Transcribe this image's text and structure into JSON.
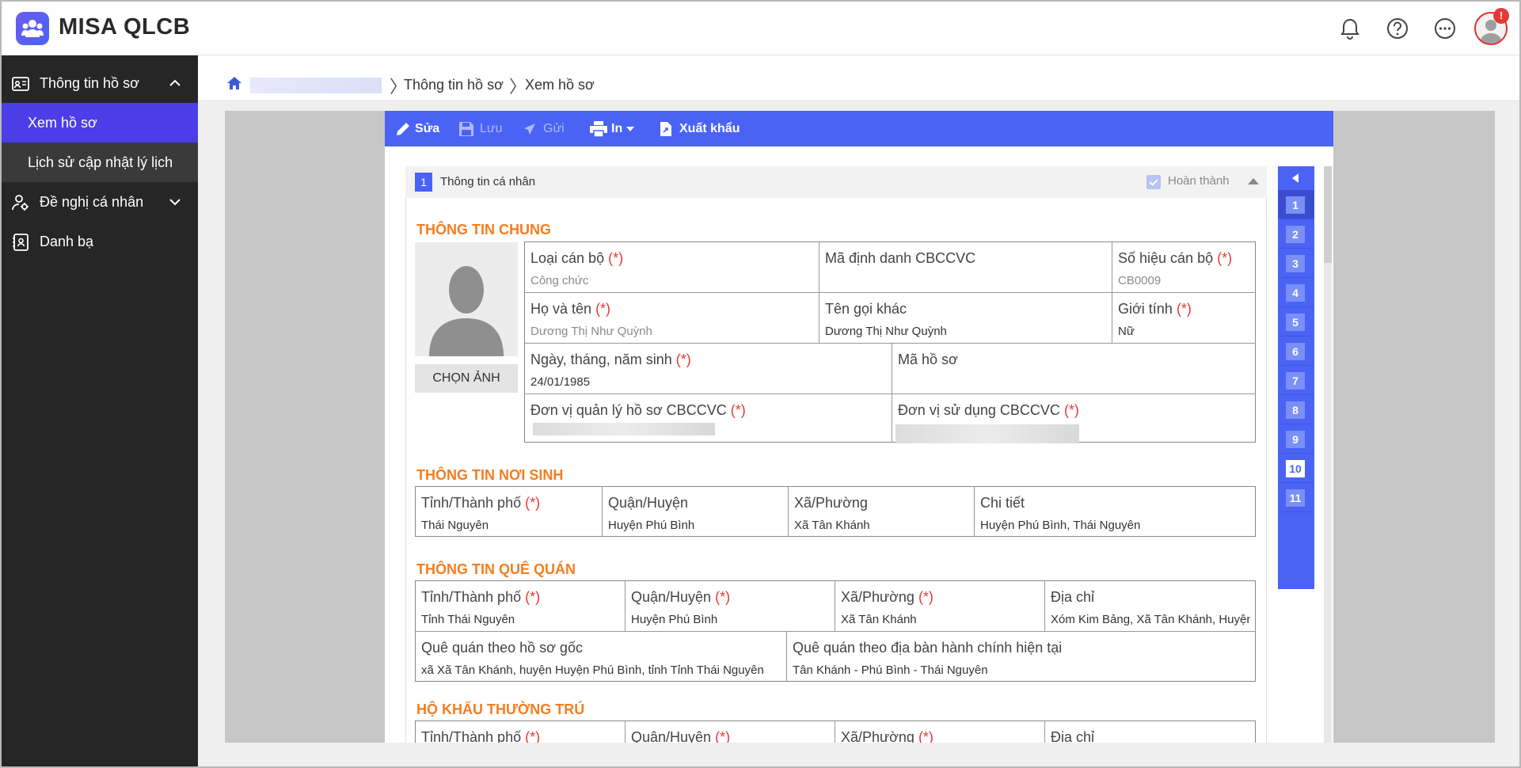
{
  "app": {
    "title": "MISA QLCB",
    "notification_badge": "!"
  },
  "sidebar": {
    "items": [
      {
        "label": "Thông tin hồ sơ",
        "icon": "id-card-icon",
        "expanded": true
      },
      {
        "label": "Xem hồ sơ",
        "active": true
      },
      {
        "label": "Lịch sử cập nhật lý lịch"
      },
      {
        "label": "Đề nghị cá nhân",
        "icon": "user-settings-icon",
        "expanded": false
      },
      {
        "label": "Danh bạ",
        "icon": "contacts-icon"
      }
    ]
  },
  "breadcrumb": {
    "items": [
      "Thông tin hồ sơ",
      "Xem hồ sơ"
    ]
  },
  "toolbar": {
    "edit": "Sửa",
    "save": "Lưu",
    "send": "Gửi",
    "print": "In",
    "export": "Xuất khẩu"
  },
  "panel": {
    "number": "1",
    "title": "Thông tin cá nhân",
    "status": "Hoàn thành"
  },
  "choose_photo": "CHỌN ẢNH",
  "required_mark": "(*)",
  "general": {
    "title": "THÔNG TIN CHUNG",
    "loai_can_bo": {
      "label": "Loại cán bộ",
      "value": "Công chức"
    },
    "ma_dinh_danh": {
      "label": "Mã định danh CBCCVC",
      "value": ""
    },
    "so_hieu": {
      "label": "Số hiệu cán bộ",
      "value": "CB0009"
    },
    "ho_ten": {
      "label": "Họ và tên",
      "value": "Dương Thị Như Quỳnh"
    },
    "ten_goi_khac": {
      "label": "Tên gọi khác",
      "value": "Dương Thị Như Quỳnh"
    },
    "gioi_tinh": {
      "label": "Giới tính",
      "value": "Nữ"
    },
    "ngay_sinh": {
      "label": "Ngày, tháng, năm sinh",
      "value": "24/01/1985"
    },
    "ma_ho_so": {
      "label": "Mã hồ sơ",
      "value": ""
    },
    "don_vi_quan_ly": {
      "label": "Đơn vị quản lý hồ sơ CBCCVC"
    },
    "don_vi_su_dung": {
      "label": "Đơn vị sử dụng CBCCVC"
    }
  },
  "birthplace": {
    "title": "THÔNG TIN NƠI SINH",
    "cells": [
      {
        "label": "Tỉnh/Thành phố",
        "required": true,
        "value": "Thái Nguyên"
      },
      {
        "label": "Quận/Huyện",
        "required": false,
        "value": "Huyện Phú Bình"
      },
      {
        "label": "Xã/Phường",
        "required": false,
        "value": "Xã Tân Khánh"
      },
      {
        "label": "Chi tiết",
        "required": false,
        "value": "Huyện Phú Bình, Thái Nguyên"
      }
    ]
  },
  "hometown": {
    "title": "THÔNG TIN QUÊ QUÁN",
    "cells": [
      {
        "label": "Tỉnh/Thành phố",
        "required": true,
        "value": "Tỉnh Thái Nguyên"
      },
      {
        "label": "Quận/Huyện",
        "required": true,
        "value": "Huyện Phú Bình"
      },
      {
        "label": "Xã/Phường",
        "required": true,
        "value": "Xã Tân Khánh"
      },
      {
        "label": "Địa chỉ",
        "required": false,
        "value": "Xóm Kim Bảng, Xã Tân Khánh, Huyện Phú Bình"
      }
    ],
    "original": {
      "label": "Quê quán theo hồ sơ gốc",
      "value": "xã Xã Tân Khánh, huyện Huyện Phú Bình, tỉnh Tỉnh Thái Nguyên"
    },
    "current": {
      "label": "Quê quán theo địa bàn hành chính hiện tại",
      "value": "Tân Khánh - Phú Bình - Thái Nguyên"
    }
  },
  "residence": {
    "title": "HỘ KHẨU THƯỜNG TRÚ",
    "cells": [
      {
        "label": "Tỉnh/Thành phố",
        "required": true
      },
      {
        "label": "Quận/Huyện",
        "required": true
      },
      {
        "label": "Xã/Phường",
        "required": true
      },
      {
        "label": "Địa chỉ",
        "required": false
      }
    ]
  },
  "right_nav": [
    "1",
    "2",
    "3",
    "4",
    "5",
    "6",
    "7",
    "8",
    "9",
    "10",
    "11"
  ]
}
